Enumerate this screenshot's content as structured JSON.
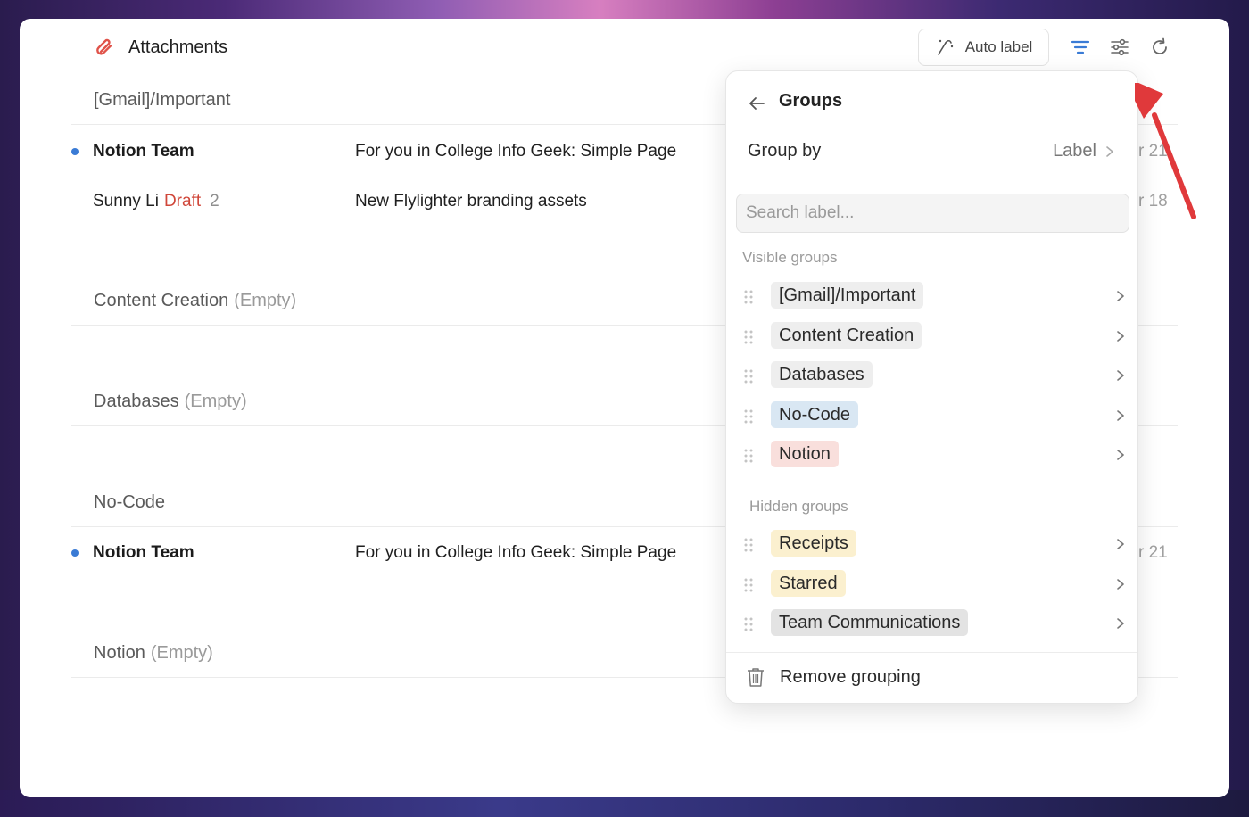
{
  "header": {
    "title": "Attachments",
    "auto_label": "Auto label",
    "icons": [
      "paperclip-icon",
      "auto-label-icon",
      "filter-lines-icon",
      "settings-sliders-icon",
      "refresh-icon"
    ]
  },
  "groups": [
    {
      "name": "[Gmail]/Important",
      "empty": ""
    },
    {
      "name": "Content Creation",
      "empty": "(Empty)"
    },
    {
      "name": "Databases",
      "empty": "(Empty)"
    },
    {
      "name": "No-Code",
      "empty": ""
    },
    {
      "name": "Notion",
      "empty": "(Empty)"
    }
  ],
  "rows": [
    {
      "sender": "Notion Team",
      "draft": "",
      "count": "",
      "subject": "For you in College Info Geek: Simple Page",
      "date": "r 21",
      "unread": true
    },
    {
      "sender": "Sunny Li",
      "draft": "Draft",
      "count": "2",
      "subject": "New Flylighter branding assets",
      "date": "r 18",
      "unread": false
    },
    {
      "sender": "Notion Team",
      "draft": "",
      "count": "",
      "subject": "For you in College Info Geek: Simple Page",
      "date": "r 21",
      "unread": true
    }
  ],
  "panel": {
    "title": "Groups",
    "group_by_label": "Group by",
    "group_by_value": "Label",
    "search_placeholder": "Search label...",
    "visible_label": "Visible groups",
    "hidden_label": "Hidden groups",
    "visible_groups": [
      {
        "name": "[Gmail]/Important",
        "color": "#eeeeee"
      },
      {
        "name": "Content Creation",
        "color": "#eeeeee"
      },
      {
        "name": "Databases",
        "color": "#eeeeee"
      },
      {
        "name": "No-Code",
        "color": "#d9e7f3"
      },
      {
        "name": "Notion",
        "color": "#f9dfdc"
      }
    ],
    "hidden_groups": [
      {
        "name": "Receipts",
        "color": "#fbf0cf"
      },
      {
        "name": "Starred",
        "color": "#fbf0cf"
      },
      {
        "name": "Team Communications",
        "color": "#e3e3e3"
      }
    ],
    "remove_label": "Remove grouping"
  },
  "colors": {
    "accent": "#3a7bd5",
    "draft": "#d0473a",
    "arrow": "#e0393b"
  }
}
